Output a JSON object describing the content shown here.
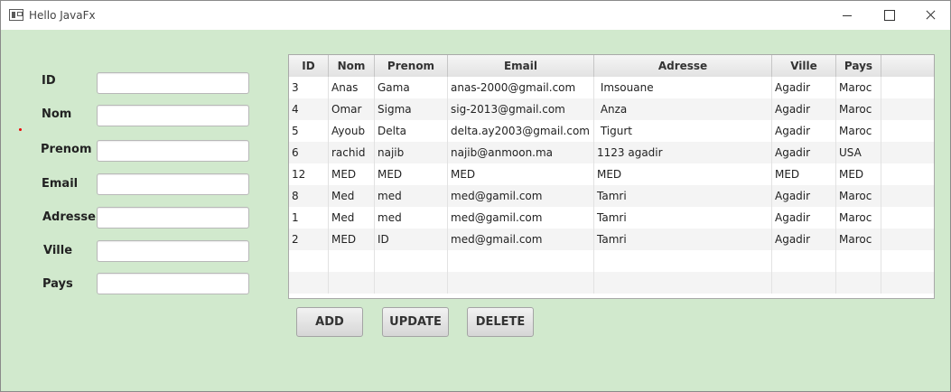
{
  "window": {
    "title": "Hello JavaFx"
  },
  "form": {
    "fields": [
      {
        "label": "ID",
        "value": ""
      },
      {
        "label": "Nom",
        "value": ""
      },
      {
        "label": "Prenom",
        "value": ""
      },
      {
        "label": "Email",
        "value": ""
      },
      {
        "label": "Adresse",
        "value": ""
      },
      {
        "label": "Ville",
        "value": ""
      },
      {
        "label": "Pays",
        "value": ""
      }
    ]
  },
  "table": {
    "columns": [
      "ID",
      "Nom",
      "Prenom",
      "Email",
      "Adresse",
      "Ville",
      "Pays"
    ],
    "rows": [
      [
        "3",
        "Anas",
        "Gama",
        "anas-2000@gmail.com",
        " Imsouane",
        "Agadir",
        "Maroc"
      ],
      [
        "4",
        "Omar",
        "Sigma",
        "sig-2013@gmail.com",
        " Anza",
        "Agadir",
        "Maroc"
      ],
      [
        "5",
        "Ayoub",
        "Delta",
        "delta.ay2003@gmail.com",
        " Tigurt",
        "Agadir",
        "Maroc"
      ],
      [
        "6",
        "rachid",
        "najib",
        "najib@anmoon.ma",
        "1123 agadir",
        "Agadir",
        "USA"
      ],
      [
        "12",
        "MED",
        "MED",
        "MED",
        "MED",
        "MED",
        "MED"
      ],
      [
        "8",
        "Med",
        "med",
        "med@gamil.com",
        "Tamri",
        "Agadir",
        "Maroc"
      ],
      [
        "1",
        "Med",
        "med",
        "med@gamil.com",
        "Tamri",
        "Agadir",
        "Maroc"
      ],
      [
        "2",
        "MED",
        "ID",
        "med@gmail.com",
        "Tamri",
        "Agadir",
        "Maroc"
      ]
    ]
  },
  "buttons": {
    "add": "ADD",
    "update": "UPDATE",
    "delete": "DELETE"
  },
  "colors": {
    "background": "#d1e9cd",
    "header": "#e8e8e8"
  }
}
